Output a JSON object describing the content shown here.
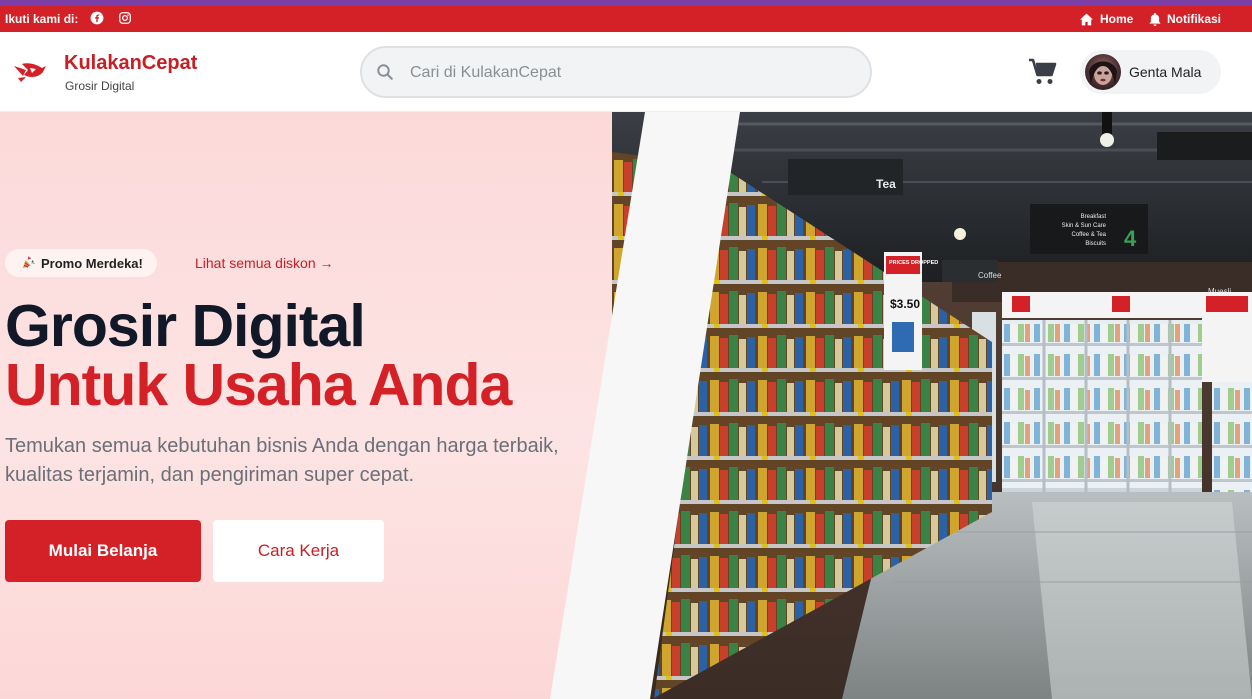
{
  "topbar": {
    "follow_label": "Ikuti kami di:",
    "social_icons": [
      "facebook-icon",
      "instagram-icon"
    ],
    "home_label": "Home",
    "notif_label": "Notifikasi"
  },
  "header": {
    "brand": "KulakanCepat",
    "tagline": "Grosir Digital",
    "search_placeholder": "Cari di KulakanCepat",
    "user_name": "Genta Mala"
  },
  "hero": {
    "promo_badge": "Promo Merdeka!",
    "promo_link": "Lihat semua diskon →",
    "title_line1": "Grosir Digital",
    "title_line2": "Untuk Usaha Anda",
    "subtitle": "Temukan semua kebutuhan bisnis Anda dengan harga terbaik, kualitas terjamin, dan pengiriman super cepat.",
    "primary_button": "Mulai Belanja",
    "secondary_button": "Cara Kerja"
  },
  "photo_signs": {
    "tea": "Tea",
    "prices_dropped": "PRICES DROPPED",
    "price": "$3.50",
    "aisle_number": "4",
    "aisle_list": [
      "Breakfast",
      "Skin & Sun Care",
      "Coffee & Tea",
      "Biscuits"
    ],
    "coffee": "Coffee",
    "muesli": "Muesli"
  },
  "colors": {
    "brand_red": "#d42127",
    "accent_purple": "#7b3fa6",
    "title_dark": "#111827"
  }
}
